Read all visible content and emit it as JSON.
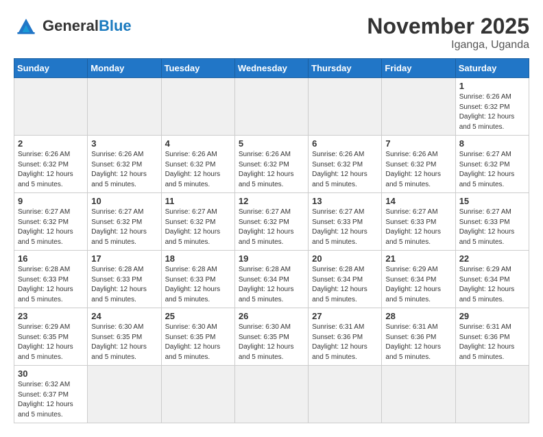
{
  "header": {
    "logo_general": "General",
    "logo_blue": "Blue",
    "month_title": "November 2025",
    "location": "Iganga, Uganda"
  },
  "days_of_week": [
    "Sunday",
    "Monday",
    "Tuesday",
    "Wednesday",
    "Thursday",
    "Friday",
    "Saturday"
  ],
  "weeks": [
    [
      {
        "day": "",
        "empty": true
      },
      {
        "day": "",
        "empty": true
      },
      {
        "day": "",
        "empty": true
      },
      {
        "day": "",
        "empty": true
      },
      {
        "day": "",
        "empty": true
      },
      {
        "day": "",
        "empty": true
      },
      {
        "day": "1",
        "sunrise": "6:26 AM",
        "sunset": "6:32 PM",
        "daylight": "12 hours and 5 minutes."
      }
    ],
    [
      {
        "day": "2",
        "sunrise": "6:26 AM",
        "sunset": "6:32 PM",
        "daylight": "12 hours and 5 minutes."
      },
      {
        "day": "3",
        "sunrise": "6:26 AM",
        "sunset": "6:32 PM",
        "daylight": "12 hours and 5 minutes."
      },
      {
        "day": "4",
        "sunrise": "6:26 AM",
        "sunset": "6:32 PM",
        "daylight": "12 hours and 5 minutes."
      },
      {
        "day": "5",
        "sunrise": "6:26 AM",
        "sunset": "6:32 PM",
        "daylight": "12 hours and 5 minutes."
      },
      {
        "day": "6",
        "sunrise": "6:26 AM",
        "sunset": "6:32 PM",
        "daylight": "12 hours and 5 minutes."
      },
      {
        "day": "7",
        "sunrise": "6:26 AM",
        "sunset": "6:32 PM",
        "daylight": "12 hours and 5 minutes."
      },
      {
        "day": "8",
        "sunrise": "6:27 AM",
        "sunset": "6:32 PM",
        "daylight": "12 hours and 5 minutes."
      }
    ],
    [
      {
        "day": "9",
        "sunrise": "6:27 AM",
        "sunset": "6:32 PM",
        "daylight": "12 hours and 5 minutes."
      },
      {
        "day": "10",
        "sunrise": "6:27 AM",
        "sunset": "6:32 PM",
        "daylight": "12 hours and 5 minutes."
      },
      {
        "day": "11",
        "sunrise": "6:27 AM",
        "sunset": "6:32 PM",
        "daylight": "12 hours and 5 minutes."
      },
      {
        "day": "12",
        "sunrise": "6:27 AM",
        "sunset": "6:32 PM",
        "daylight": "12 hours and 5 minutes."
      },
      {
        "day": "13",
        "sunrise": "6:27 AM",
        "sunset": "6:33 PM",
        "daylight": "12 hours and 5 minutes."
      },
      {
        "day": "14",
        "sunrise": "6:27 AM",
        "sunset": "6:33 PM",
        "daylight": "12 hours and 5 minutes."
      },
      {
        "day": "15",
        "sunrise": "6:27 AM",
        "sunset": "6:33 PM",
        "daylight": "12 hours and 5 minutes."
      }
    ],
    [
      {
        "day": "16",
        "sunrise": "6:28 AM",
        "sunset": "6:33 PM",
        "daylight": "12 hours and 5 minutes."
      },
      {
        "day": "17",
        "sunrise": "6:28 AM",
        "sunset": "6:33 PM",
        "daylight": "12 hours and 5 minutes."
      },
      {
        "day": "18",
        "sunrise": "6:28 AM",
        "sunset": "6:33 PM",
        "daylight": "12 hours and 5 minutes."
      },
      {
        "day": "19",
        "sunrise": "6:28 AM",
        "sunset": "6:34 PM",
        "daylight": "12 hours and 5 minutes."
      },
      {
        "day": "20",
        "sunrise": "6:28 AM",
        "sunset": "6:34 PM",
        "daylight": "12 hours and 5 minutes."
      },
      {
        "day": "21",
        "sunrise": "6:29 AM",
        "sunset": "6:34 PM",
        "daylight": "12 hours and 5 minutes."
      },
      {
        "day": "22",
        "sunrise": "6:29 AM",
        "sunset": "6:34 PM",
        "daylight": "12 hours and 5 minutes."
      }
    ],
    [
      {
        "day": "23",
        "sunrise": "6:29 AM",
        "sunset": "6:35 PM",
        "daylight": "12 hours and 5 minutes."
      },
      {
        "day": "24",
        "sunrise": "6:30 AM",
        "sunset": "6:35 PM",
        "daylight": "12 hours and 5 minutes."
      },
      {
        "day": "25",
        "sunrise": "6:30 AM",
        "sunset": "6:35 PM",
        "daylight": "12 hours and 5 minutes."
      },
      {
        "day": "26",
        "sunrise": "6:30 AM",
        "sunset": "6:35 PM",
        "daylight": "12 hours and 5 minutes."
      },
      {
        "day": "27",
        "sunrise": "6:31 AM",
        "sunset": "6:36 PM",
        "daylight": "12 hours and 5 minutes."
      },
      {
        "day": "28",
        "sunrise": "6:31 AM",
        "sunset": "6:36 PM",
        "daylight": "12 hours and 5 minutes."
      },
      {
        "day": "29",
        "sunrise": "6:31 AM",
        "sunset": "6:36 PM",
        "daylight": "12 hours and 5 minutes."
      }
    ],
    [
      {
        "day": "30",
        "sunrise": "6:32 AM",
        "sunset": "6:37 PM",
        "daylight": "12 hours and 5 minutes."
      },
      {
        "day": "",
        "empty": true
      },
      {
        "day": "",
        "empty": true
      },
      {
        "day": "",
        "empty": true
      },
      {
        "day": "",
        "empty": true
      },
      {
        "day": "",
        "empty": true
      },
      {
        "day": "",
        "empty": true
      }
    ]
  ]
}
